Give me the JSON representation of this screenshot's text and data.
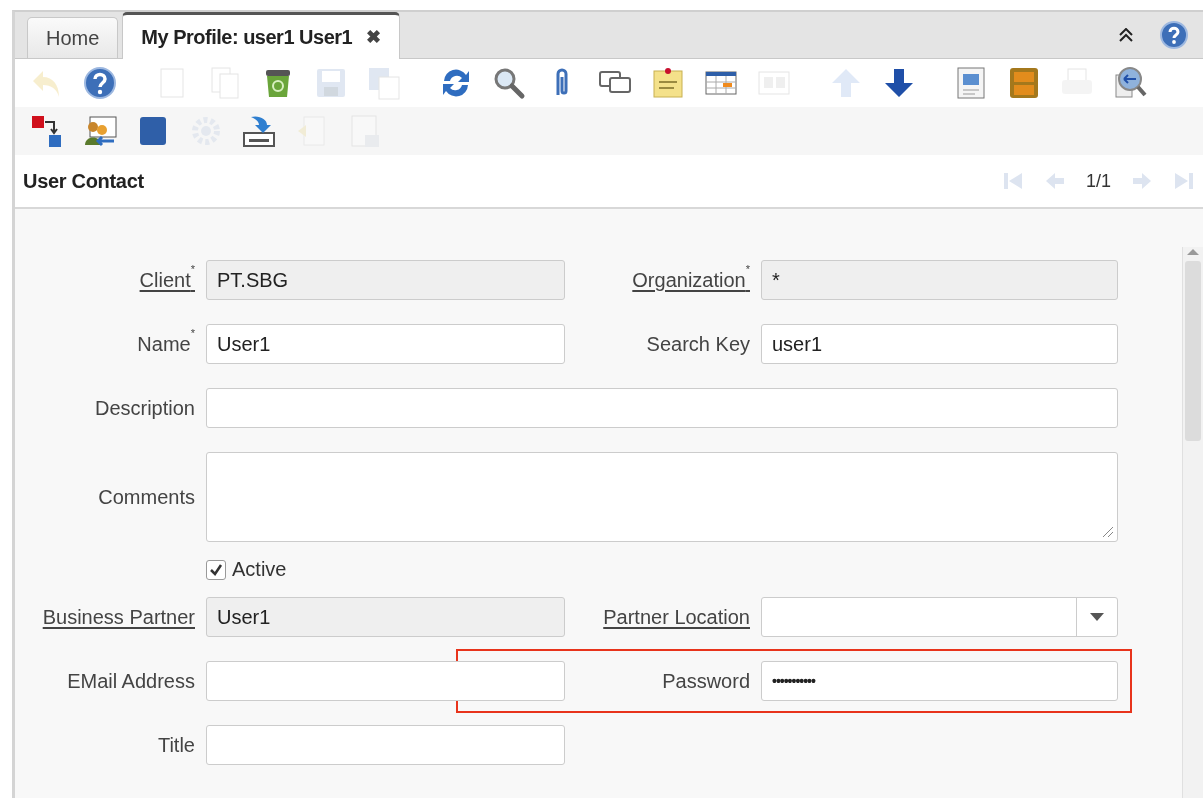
{
  "tabs": [
    {
      "label": "Home",
      "selected": false,
      "closable": false
    },
    {
      "label": "My Profile: user1 User1",
      "selected": true,
      "closable": true,
      "close": "✖"
    }
  ],
  "toolbar": {
    "rows": [
      [
        [
          {
            "kind": "undo",
            "disabled": true
          },
          {
            "kind": "help",
            "disabled": false
          }
        ],
        [
          {
            "kind": "page",
            "disabled": true
          },
          {
            "kind": "copy",
            "disabled": true
          },
          {
            "kind": "trash",
            "disabled": false
          },
          {
            "kind": "floppy",
            "disabled": true
          },
          {
            "kind": "floppycopy",
            "disabled": true
          }
        ],
        [
          {
            "kind": "refresh",
            "disabled": false
          },
          {
            "kind": "search",
            "disabled": false
          },
          {
            "kind": "paperclip",
            "disabled": false
          },
          {
            "kind": "chat",
            "disabled": false
          },
          {
            "kind": "note",
            "disabled": false
          },
          {
            "kind": "table",
            "disabled": false
          },
          {
            "kind": "windows",
            "disabled": true
          }
        ],
        [
          {
            "kind": "up",
            "disabled": true
          },
          {
            "kind": "down",
            "disabled": false
          }
        ],
        [
          {
            "kind": "document",
            "disabled": false
          },
          {
            "kind": "cabinet",
            "disabled": false
          },
          {
            "kind": "printer",
            "disabled": true
          },
          {
            "kind": "zoomback",
            "disabled": false
          }
        ]
      ],
      [
        [
          {
            "kind": "move",
            "disabled": false
          },
          {
            "kind": "people",
            "disabled": false
          },
          {
            "kind": "cube",
            "disabled": false
          },
          {
            "kind": "gear",
            "disabled": true
          },
          {
            "kind": "tray",
            "disabled": false
          },
          {
            "kind": "pagearrow",
            "disabled": true
          },
          {
            "kind": "panel",
            "disabled": true
          }
        ]
      ]
    ]
  },
  "section": {
    "title": "User Contact",
    "counter": "1/1",
    "nav": [
      {
        "kind": "first",
        "disabled": true
      },
      {
        "kind": "prev",
        "disabled": true
      },
      {
        "kind": "next",
        "disabled": true
      },
      {
        "kind": "last",
        "disabled": true
      }
    ]
  },
  "form": {
    "rows": [
      [
        {
          "kind": "readonly",
          "label": "Client$^{*}$",
          "link": true,
          "value": "PT.SBG"
        },
        {
          "kind": "readonly",
          "label": "Organization$^{*}$",
          "link": true,
          "value": "*"
        }
      ],
      [
        {
          "kind": "text",
          "label": "Name$^{*}$",
          "link": false,
          "value": "User1"
        },
        {
          "kind": "text",
          "label": "Search Key",
          "link": false,
          "value": "user1"
        }
      ],
      [
        {
          "kind": "wide",
          "label": "Description",
          "link": false
        }
      ],
      [
        {
          "kind": "textarea",
          "label": "Comments",
          "link": false
        }
      ],
      [
        {
          "kind": "checkbox",
          "label": "Active",
          "checked": true
        }
      ],
      [
        {
          "kind": "readonly",
          "label": "Business Partner",
          "link": true,
          "value": "User1"
        },
        {
          "kind": "select",
          "label": "Partner Location",
          "link": true
        }
      ],
      [
        {
          "kind": "text",
          "label": "EMail Address",
          "link": false
        },
        {
          "kind": "password",
          "label": "Password",
          "link": false,
          "value": "•••••••••••",
          "highlighted": true
        }
      ],
      [
        {
          "kind": "text",
          "label": "Title",
          "link": false
        }
      ]
    ]
  }
}
